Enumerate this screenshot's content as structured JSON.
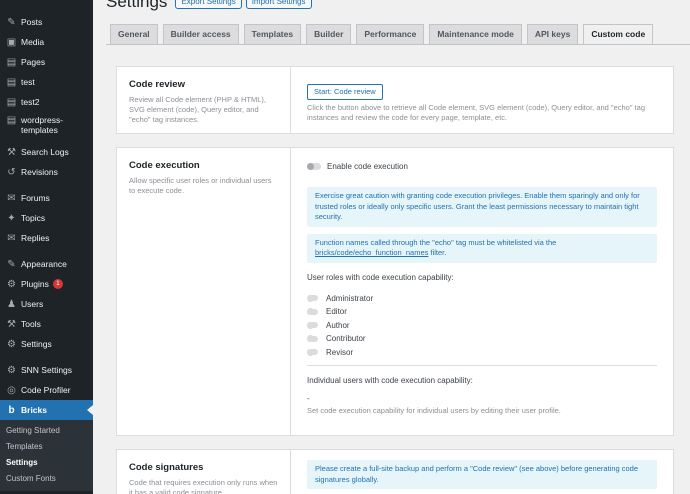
{
  "sidebar": {
    "items": [
      {
        "icon": "pin-icon",
        "glyph": "✎",
        "label": "Posts"
      },
      {
        "icon": "media-icon",
        "glyph": "▣",
        "label": "Media"
      },
      {
        "icon": "page-icon",
        "glyph": "▤",
        "label": "Pages"
      },
      {
        "icon": "page-icon",
        "glyph": "▤",
        "label": "test"
      },
      {
        "icon": "page-icon",
        "glyph": "▤",
        "label": "test2"
      },
      {
        "icon": "page-icon",
        "glyph": "▤",
        "label": "wordpress-templates"
      },
      {
        "icon": "hammer-icon",
        "glyph": "⚒",
        "label": "Search Logs"
      },
      {
        "icon": "history-icon",
        "glyph": "↺",
        "label": "Revisions"
      },
      {
        "icon": "forum-icon",
        "glyph": "✉",
        "label": "Forums"
      },
      {
        "icon": "topics-icon",
        "glyph": "✦",
        "label": "Topics"
      },
      {
        "icon": "replies-icon",
        "glyph": "✉",
        "label": "Replies"
      },
      {
        "icon": "appearance-icon",
        "glyph": "✎",
        "label": "Appearance"
      },
      {
        "icon": "plugins-icon",
        "glyph": "⚙",
        "label": "Plugins",
        "badge": "1"
      },
      {
        "icon": "users-icon",
        "glyph": "♟",
        "label": "Users"
      },
      {
        "icon": "tools-icon",
        "glyph": "⚒",
        "label": "Tools"
      },
      {
        "icon": "settings-icon",
        "glyph": "⚙",
        "label": "Settings"
      },
      {
        "icon": "settings-icon",
        "glyph": "⚙",
        "label": "SNN Settings"
      },
      {
        "icon": "code-icon",
        "glyph": "◎",
        "label": "Code Profiler"
      },
      {
        "icon": "bricks-logo-icon",
        "glyph": "b",
        "label": "Bricks"
      }
    ],
    "submenu": [
      "Getting Started",
      "Templates",
      "Settings",
      "Custom Fonts"
    ]
  },
  "header": {
    "title": "Settings",
    "export_label": "Export Settings",
    "import_label": "Import Settings"
  },
  "tabs": [
    "General",
    "Builder access",
    "Templates",
    "Builder",
    "Performance",
    "Maintenance mode",
    "API keys",
    "Custom code"
  ],
  "code_review": {
    "title": "Code review",
    "desc": "Review all Code element (PHP & HTML), SVG element (code), Query editor, and \"echo\" tag instances.",
    "button": "Start: Code review",
    "help": "Click the button above to retrieve all Code element, SVG element (code), Query editor, and \"echo\" tag instances and review the code for every page, template, etc."
  },
  "code_execution": {
    "title": "Code execution",
    "desc": "Allow specific user roles or individual users to execute code.",
    "toggle_label": "Enable code execution",
    "notice1": "Exercise great caution with granting code execution privileges. Enable them sparingly and only for trusted roles or ideally only specific users. Grant the least permissions necessary to maintain tight security.",
    "notice2_pre": "Function names called through the \"echo\" tag must be whitelisted via the",
    "notice2_link": "bricks/code/echo_function_names",
    "notice2_post": " filter.",
    "roles_label": "User roles with code execution capability:",
    "roles": [
      "Administrator",
      "Editor",
      "Author",
      "Contributor",
      "Revisor"
    ],
    "users_label": "Individual users with code execution capability:",
    "users_value": "-",
    "users_help": "Set code execution capability for individual users by editing their user profile."
  },
  "code_signatures": {
    "title": "Code signatures",
    "desc": "Code that requires execution only runs when it has a valid code signature.",
    "notice": "Please create a full-site backup and perform a \"Code review\" (see above) before generating code signatures globally."
  }
}
